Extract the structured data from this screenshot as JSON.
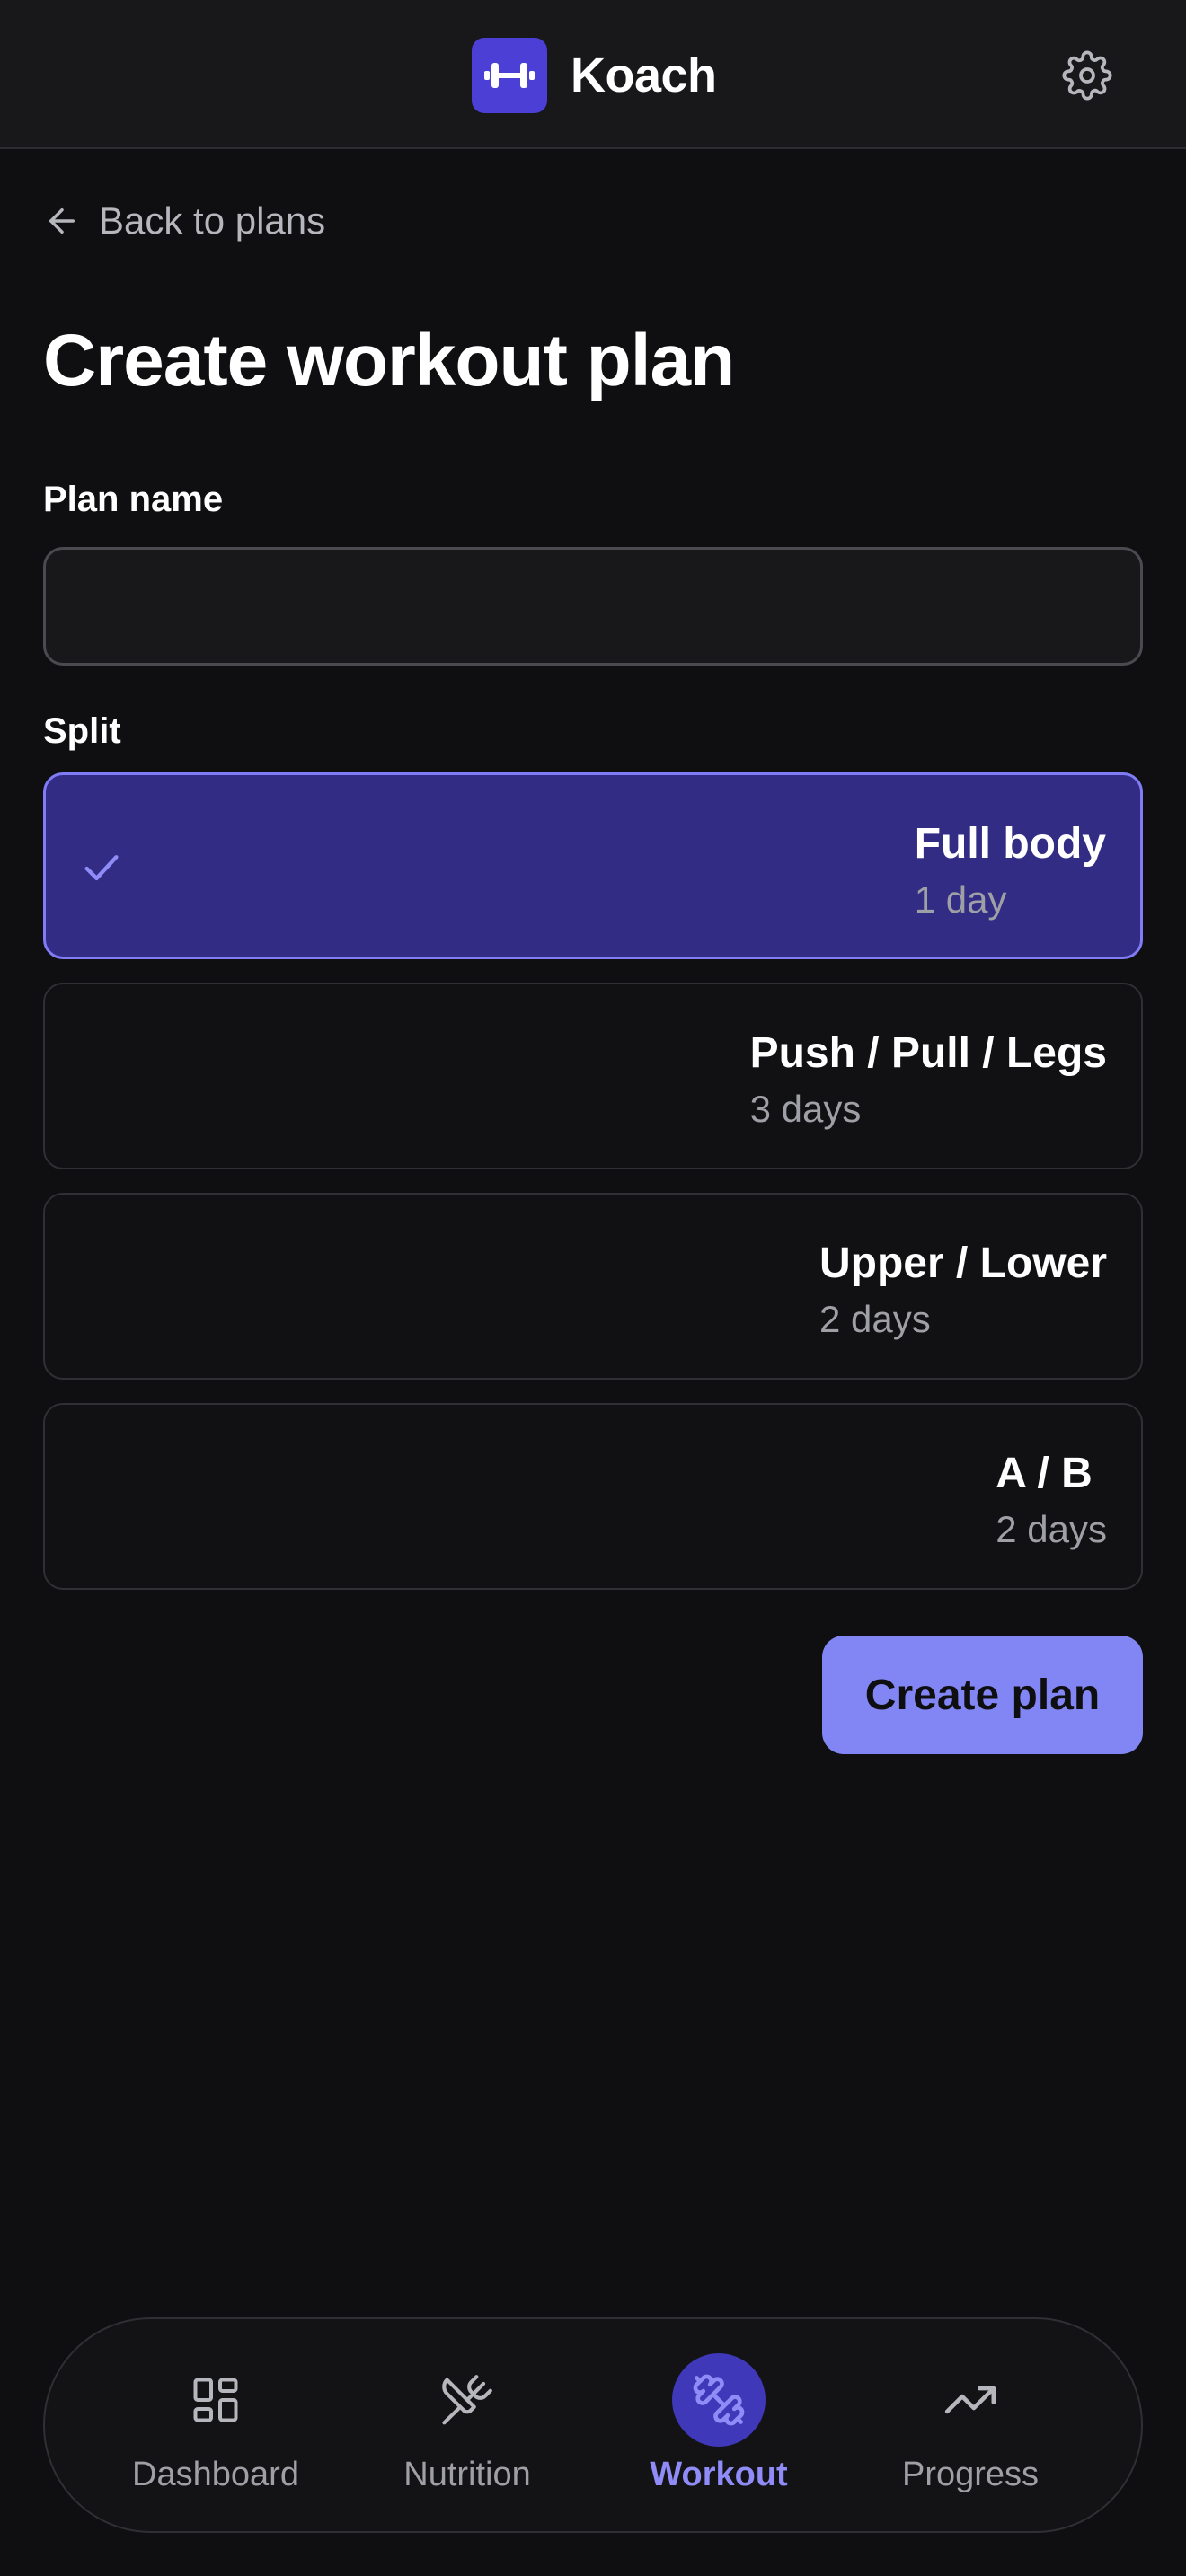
{
  "header": {
    "app_name": "Koach",
    "logo_icon": "dumbbell-icon",
    "settings_icon": "gear-icon"
  },
  "back_link": {
    "label": "Back to plans",
    "icon": "arrow-left-icon"
  },
  "page_title": "Create workout plan",
  "form": {
    "plan_name_label": "Plan name",
    "plan_name_value": "",
    "plan_name_placeholder": "",
    "split_label": "Split",
    "split_options": [
      {
        "title": "Full body",
        "subtitle": "1 day",
        "selected": true
      },
      {
        "title": "Push / Pull / Legs",
        "subtitle": "3 days",
        "selected": false
      },
      {
        "title": "Upper / Lower",
        "subtitle": "2 days",
        "selected": false
      },
      {
        "title": "A / B",
        "subtitle": "2 days",
        "selected": false
      }
    ],
    "submit_label": "Create plan"
  },
  "bottom_nav": {
    "items": [
      {
        "label": "Dashboard",
        "icon": "dashboard-icon",
        "active": false
      },
      {
        "label": "Nutrition",
        "icon": "fork-knife-icon",
        "active": false
      },
      {
        "label": "Workout",
        "icon": "dumbbell-icon",
        "active": true
      },
      {
        "label": "Progress",
        "icon": "trending-up-icon",
        "active": false
      }
    ]
  },
  "colors": {
    "background": "#0f0f11",
    "accent": "#8286f4",
    "selected_option_bg": "#322c85",
    "logo_bg": "#4b3fd6"
  }
}
